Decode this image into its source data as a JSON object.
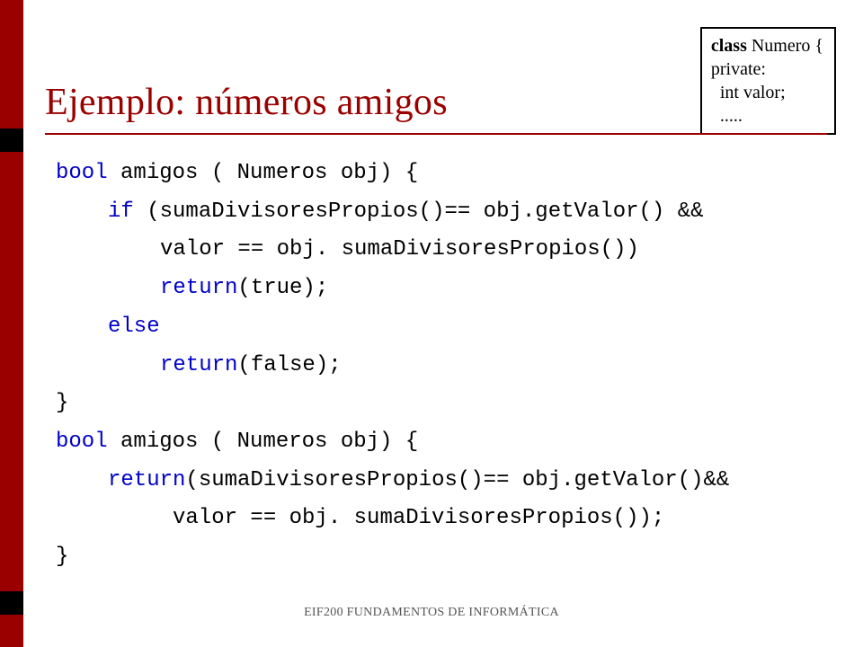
{
  "title": "Ejemplo: números amigos",
  "classBox": {
    "line1_keyword": "class",
    "line1_rest": " Numero {",
    "line2": "private:",
    "line3": "  int valor;",
    "line4": "  ....."
  },
  "code": {
    "l1_kw": "bool",
    "l1_rest": " amigos ( Numeros obj) {",
    "l2_kw": "if",
    "l2_rest": " (sumaDivisoresPropios()== obj.getValor() &&",
    "l3": "valor == obj. sumaDivisoresPropios())",
    "l4_kw": "return",
    "l4_rest": "(true);",
    "l5_kw": "else",
    "l6_kw": "return",
    "l6_rest": "(false);",
    "l7": "}",
    "l8_kw": "bool",
    "l8_rest": " amigos ( Numeros obj) {",
    "l9_kw": "return",
    "l9_rest": "(sumaDivisoresPropios()== obj.getValor()&&",
    "l10": "valor == obj. sumaDivisoresPropios());",
    "l11": "}"
  },
  "footer": "EIF200 FUNDAMENTOS DE INFORMÁTICA"
}
